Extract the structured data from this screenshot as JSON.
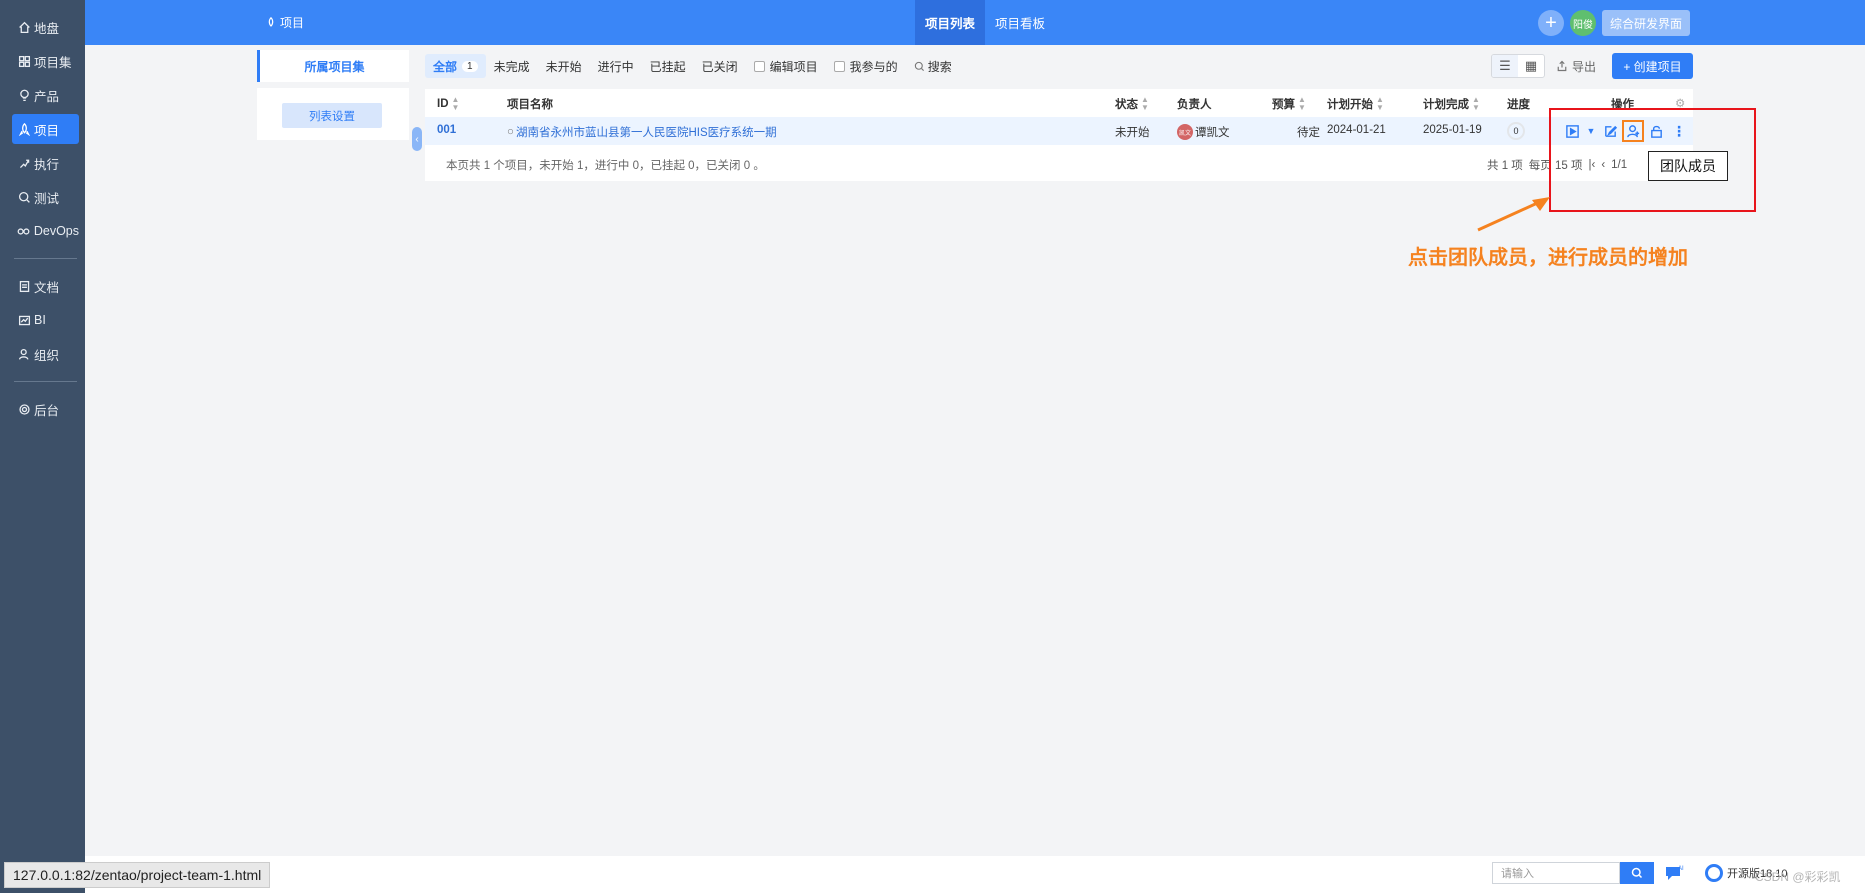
{
  "sidebar": {
    "items": [
      {
        "icon": "home-icon",
        "label": "地盘"
      },
      {
        "icon": "grid-icon",
        "label": "项目集"
      },
      {
        "icon": "bulb-icon",
        "label": "产品"
      },
      {
        "icon": "rocket-icon",
        "label": "项目",
        "active": true
      },
      {
        "icon": "run-icon",
        "label": "执行"
      },
      {
        "icon": "test-icon",
        "label": "测试"
      },
      {
        "icon": "infinity-icon",
        "label": "DevOps"
      },
      {
        "icon": "doc-icon",
        "label": "文档"
      },
      {
        "icon": "chart-icon",
        "label": "BI"
      },
      {
        "icon": "people-icon",
        "label": "组织"
      },
      {
        "icon": "gear-icon",
        "label": "后台"
      }
    ]
  },
  "header": {
    "breadcrumb": "项目",
    "tabs": [
      "项目列表",
      "项目看板"
    ],
    "active_tab": "项目列表",
    "avatar_text": "阳俊",
    "workspace_button": "综合研发界面"
  },
  "left_panel": {
    "group_label": "所属项目集",
    "settings_button": "列表设置"
  },
  "filters": {
    "all_label": "全部",
    "all_count": "1",
    "chips": [
      "未完成",
      "未开始",
      "进行中",
      "已挂起",
      "已关闭"
    ],
    "checkbox_edit": "编辑项目",
    "checkbox_mine": "我参与的",
    "search": "搜索"
  },
  "toolbar": {
    "export": "导出",
    "create": "+ 创建项目"
  },
  "table": {
    "columns": {
      "id": "ID",
      "name": "项目名称",
      "status": "状态",
      "owner": "负责人",
      "budget": "预算",
      "plan_start": "计划开始",
      "plan_end": "计划完成",
      "progress": "进度",
      "actions": "操作"
    },
    "rows": [
      {
        "id": "001",
        "name": "湖南省永州市蓝山县第一人民医院HIS医疗系统一期",
        "status": "未开始",
        "owner_avatar": "凯文",
        "owner": "谭凯文",
        "budget": "待定",
        "plan_start": "2024-01-21",
        "plan_end": "2025-01-19",
        "progress": "0"
      }
    ],
    "footer_summary": "本页共 1 个项目，未开始 1，进行中 0，已挂起 0，已关闭 0 。",
    "pager": {
      "total": "共 1 项",
      "per_page": "每页 15 项",
      "page": "1/1"
    }
  },
  "tooltip": "团队成员",
  "annotation": {
    "text": "点击团队成员，进行成员的增加",
    "color": "#f5821f",
    "box_color": "#e8141b"
  },
  "statusbar": {
    "url": "127.0.0.1:82/zentao/project-team-1.html",
    "search_placeholder": "请输入",
    "open_source": "开源版18.10",
    "watermark": "CSDN @彩彩凯"
  },
  "colors": {
    "primary": "#2f7df6",
    "sidebar": "#3d5068",
    "header": "#3a86f7"
  }
}
